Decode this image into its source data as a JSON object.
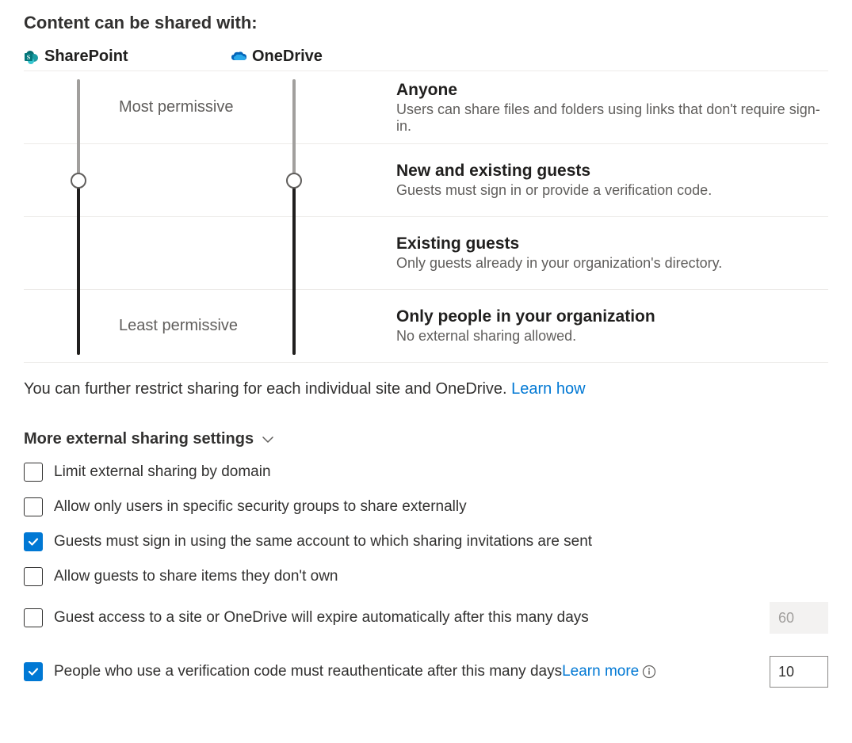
{
  "section_title": "Content can be shared with:",
  "products": {
    "sharepoint": "SharePoint",
    "onedrive": "OneDrive"
  },
  "permissive_labels": {
    "most": "Most permissive",
    "least": "Least permissive"
  },
  "levels": [
    {
      "title": "Anyone",
      "description": "Users can share files and folders using links that don't require sign-in."
    },
    {
      "title": "New and existing guests",
      "description": "Guests must sign in or provide a verification code."
    },
    {
      "title": "Existing guests",
      "description": "Only guests already in your organization's directory."
    },
    {
      "title": "Only people in your organization",
      "description": "No external sharing allowed."
    }
  ],
  "sliders": {
    "sharepoint_level_index": 1,
    "onedrive_level_index": 1
  },
  "restrict_note": "You can further restrict sharing for each individual site and OneDrive.",
  "learn_how": "Learn how",
  "more_settings_title": "More external sharing settings",
  "checkboxes": [
    {
      "label": "Limit external sharing by domain",
      "checked": false
    },
    {
      "label": "Allow only users in specific security groups to share externally",
      "checked": false
    },
    {
      "label": "Guests must sign in using the same account to which sharing invitations are sent",
      "checked": true
    },
    {
      "label": "Allow guests to share items they don't own",
      "checked": false
    },
    {
      "label": "Guest access to a site or OneDrive will expire automatically after this many days",
      "checked": false,
      "has_days_input": true,
      "days_value": "60",
      "input_disabled": true
    },
    {
      "label": "People who use a verification code must reauthenticate after this many days",
      "checked": true,
      "has_days_input": true,
      "days_value": "10",
      "input_disabled": false,
      "learn_more": "Learn more",
      "has_info": true
    }
  ]
}
